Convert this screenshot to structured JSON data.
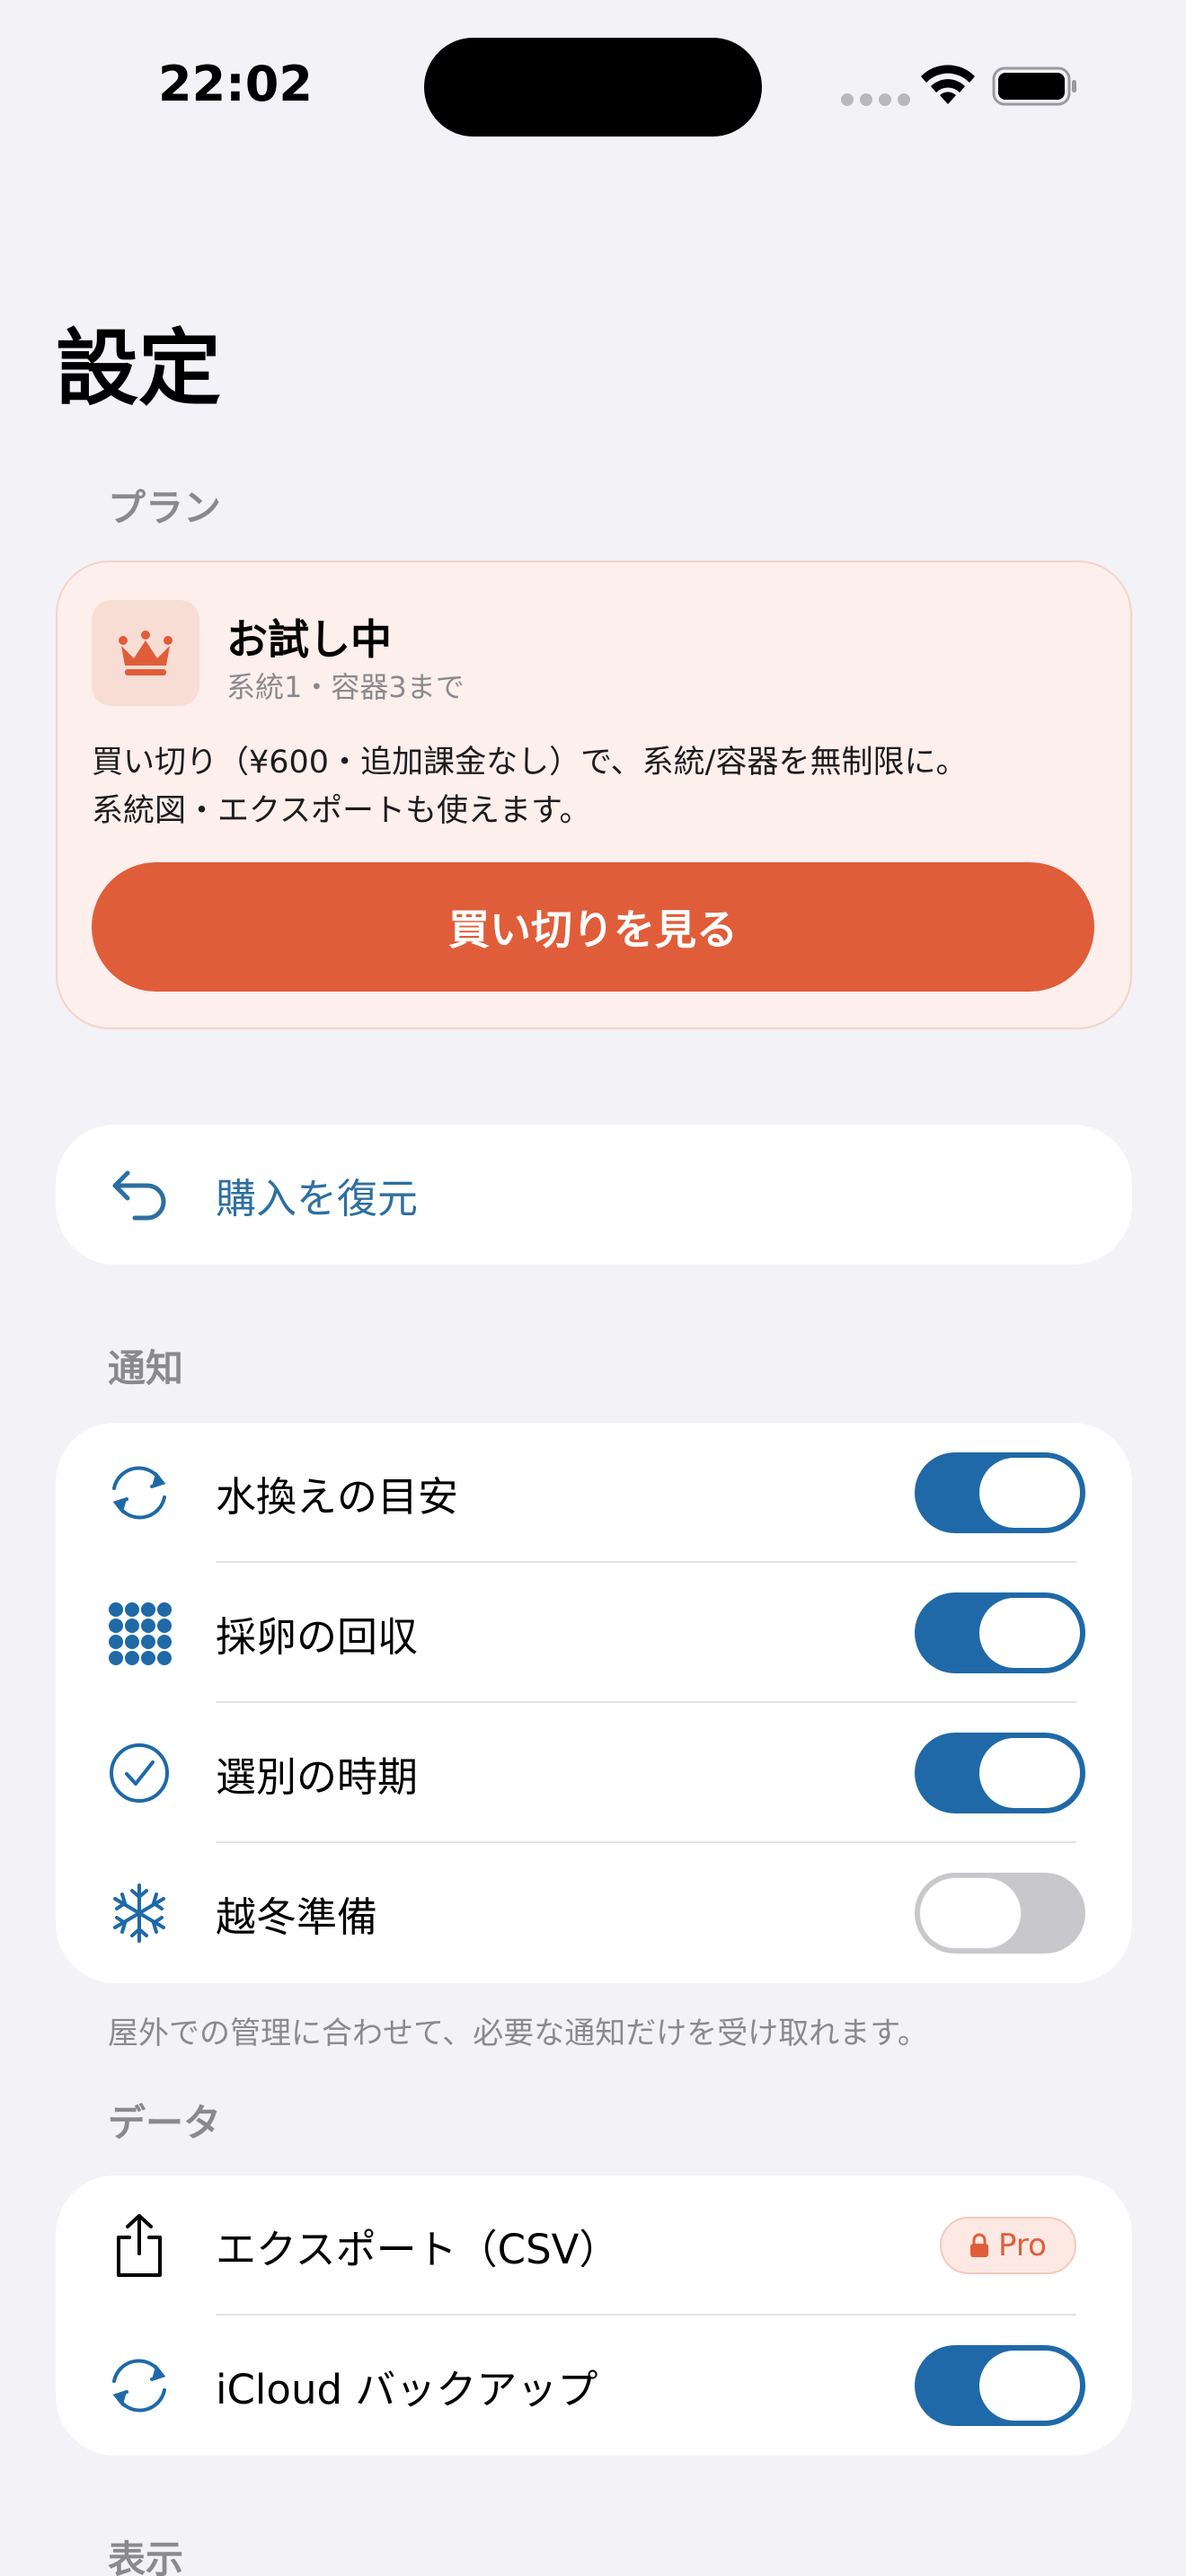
{
  "status_bar": {
    "time": "22:02"
  },
  "page": {
    "title": "設定"
  },
  "plan": {
    "section_header": "プラン",
    "title": "お試し中",
    "subtitle": "系統1・容器3まで",
    "description_line1": "買い切り（¥600・追加課金なし）で、系統/容器を無制限に。",
    "description_line2": "系統図・エクスポートも使えます。",
    "button_label": "買い切りを見る",
    "icon": "crown-icon",
    "accent_color": "#E05D3A"
  },
  "restore": {
    "label": "購入を復元",
    "icon": "undo-arrow-icon"
  },
  "notifications": {
    "section_header": "通知",
    "footer": "屋外での管理に合わせて、必要な通知だけを受け取れます。",
    "items": [
      {
        "label": "水換えの目安",
        "icon": "refresh-icon",
        "enabled": true
      },
      {
        "label": "採卵の回収",
        "icon": "grid-dots-icon",
        "enabled": true
      },
      {
        "label": "選別の時期",
        "icon": "checkmark-circle-icon",
        "enabled": true
      },
      {
        "label": "越冬準備",
        "icon": "snowflake-icon",
        "enabled": false
      }
    ]
  },
  "data_section": {
    "section_header": "データ",
    "export": {
      "label": "エクスポート（CSV）",
      "icon": "share-icon",
      "badge": "Pro",
      "badge_icon": "lock-icon"
    },
    "icloud": {
      "label": "iCloud バックアップ",
      "icon": "sync-icon",
      "enabled": true
    }
  },
  "display_section": {
    "section_header": "表示"
  },
  "colors": {
    "toggle_on": "#1F69A8",
    "link": "#2D6FA1",
    "background": "#F2F2F7"
  }
}
